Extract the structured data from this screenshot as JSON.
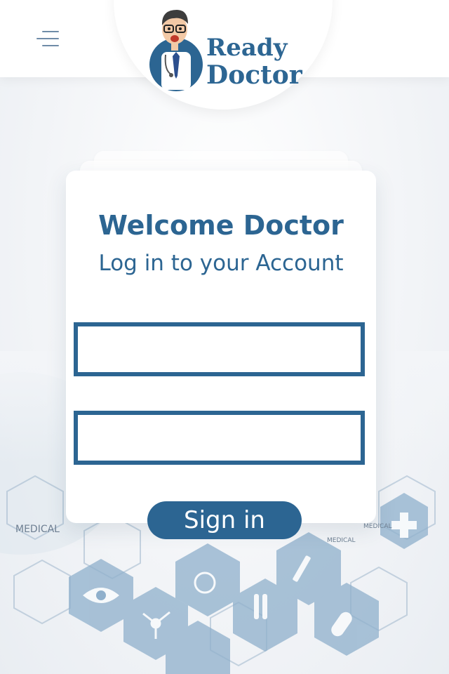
{
  "app": {
    "logo_line1": "Ready",
    "logo_line2": "Doctor"
  },
  "login": {
    "title": "Welcome Doctor",
    "subtitle": "Log in to your Account",
    "username_value": "",
    "password_value": "",
    "signin_label": "Sign in"
  },
  "background": {
    "labels": [
      "MEDICAL",
      "MEDICAL",
      "MEDICAL"
    ]
  },
  "colors": {
    "brand": "#2c6592",
    "menu_icon": "#6f8ca8",
    "background": "#f3f5f8",
    "card": "#ffffff"
  },
  "icons": [
    "menu-icon",
    "doctor-mascot-icon",
    "eye-icon",
    "molecule-icon",
    "wheelchair-icon",
    "test-tube-icon",
    "microscope-icon",
    "syringe-icon",
    "pill-icon",
    "cross-icon"
  ]
}
